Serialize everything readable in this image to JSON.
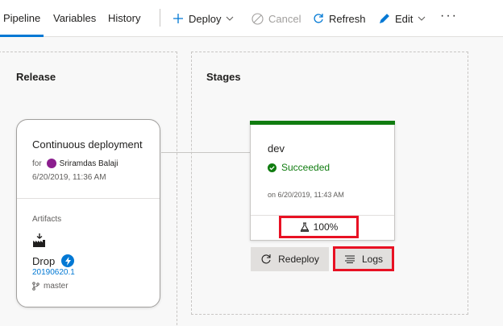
{
  "tabs": [
    {
      "label": "Pipeline",
      "active": true
    },
    {
      "label": "Variables",
      "active": false
    },
    {
      "label": "History",
      "active": false
    }
  ],
  "toolbar": {
    "deploy_label": "Deploy",
    "cancel_label": "Cancel",
    "refresh_label": "Refresh",
    "edit_label": "Edit",
    "more_label": "···"
  },
  "release": {
    "panel_title": "Release",
    "trigger_title": "Continuous deployment",
    "for_label": "for",
    "user": "Sriramdas Balaji",
    "date": "6/20/2019, 11:36 AM",
    "artifacts_label": "Artifacts",
    "artifact_name": "Drop",
    "build_number": "20190620.1",
    "branch": "master"
  },
  "stages": {
    "panel_title": "Stages",
    "items": [
      {
        "name": "dev",
        "status": "Succeeded",
        "date": "on 6/20/2019, 11:43 AM",
        "test_pass_rate": "100%"
      }
    ],
    "redeploy_label": "Redeploy",
    "logs_label": "Logs"
  },
  "colors": {
    "accent": "#0078d4",
    "success": "#107c10",
    "highlight": "#e81123",
    "avatar": "#8b1e8e"
  },
  "icons": {
    "deploy": "plus-icon",
    "cancel": "cancel-icon",
    "refresh": "refresh-icon",
    "edit": "pencil-icon",
    "status": "check-circle-icon",
    "tests": "flask-icon",
    "logs": "logs-icon",
    "artifact": "build-icon",
    "trigger": "lightning-icon",
    "branch": "branch-icon"
  }
}
